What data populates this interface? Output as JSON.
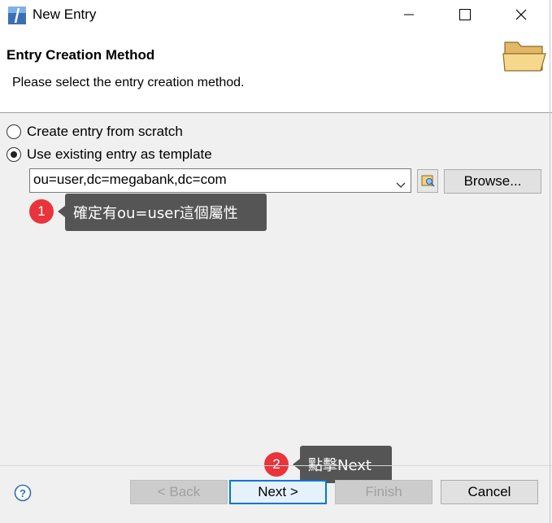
{
  "window": {
    "title": "New Entry",
    "icons": {
      "app": "eclipse-app-icon",
      "minimize": "minimize-icon",
      "maximize": "maximize-icon",
      "close": "close-icon"
    }
  },
  "header": {
    "title": "Entry Creation Method",
    "description": "Please select the entry creation method.",
    "icon": "open-folder-icon"
  },
  "options": {
    "scratch_label": "Create entry from scratch",
    "template_label": "Use existing entry as template",
    "selected": "template"
  },
  "template": {
    "value": "ou=user,dc=megabank,dc=com",
    "browse_label": "Browse...",
    "entry_browser_icon": "entry-browser-icon"
  },
  "annotations": [
    {
      "number": "1",
      "text": "確定有ou=user這個屬性"
    },
    {
      "number": "2",
      "text": "點擊Next"
    }
  ],
  "footer": {
    "help_icon": "help-icon",
    "back_label": "< Back",
    "next_label": "Next >",
    "finish_label": "Finish",
    "cancel_label": "Cancel"
  },
  "colors": {
    "annotation_badge": "#e8343a",
    "annotation_tooltip": "#555555",
    "focus_border": "#0078d7"
  }
}
